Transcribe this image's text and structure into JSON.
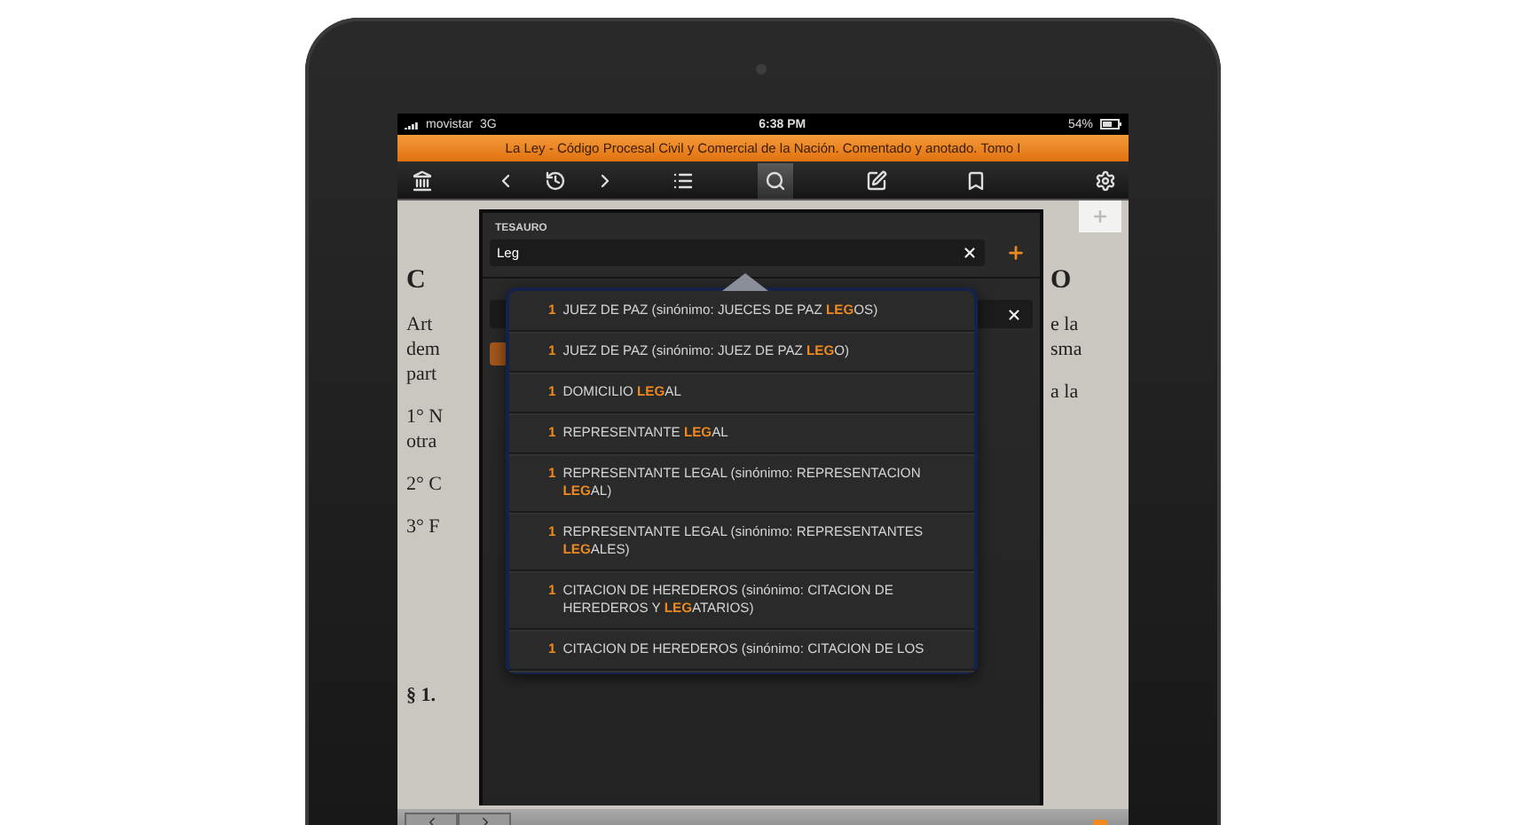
{
  "status_bar": {
    "carrier": "movistar",
    "network": "3G",
    "time": "6:38 PM",
    "battery": "54%"
  },
  "title_bar": {
    "title": "La Ley - Código Procesal Civil y Comercial de la Nación. Comentado y anotado. Tomo I"
  },
  "toolbar": {
    "items": [
      {
        "kind": "library",
        "selected": false
      },
      {
        "kind": "back",
        "selected": false
      },
      {
        "kind": "history",
        "selected": false
      },
      {
        "kind": "forward",
        "selected": false
      },
      {
        "kind": "contents",
        "selected": false
      },
      {
        "kind": "search",
        "selected": true
      },
      {
        "kind": "notes",
        "selected": false
      },
      {
        "kind": "bookmark",
        "selected": false
      },
      {
        "kind": "settings",
        "selected": false
      }
    ]
  },
  "page": {
    "left_fragments": [
      {
        "kind": "heading",
        "text": "C"
      },
      {
        "kind": "para",
        "text": "Art"
      },
      {
        "kind": "line",
        "text": "dem"
      },
      {
        "kind": "line",
        "text": "part"
      },
      {
        "kind": "para",
        "text": "1° N"
      },
      {
        "kind": "line",
        "text": "otra"
      },
      {
        "kind": "para",
        "text": "2° C"
      },
      {
        "kind": "para",
        "text": "3° F"
      },
      {
        "kind": "section",
        "text": "§ 1."
      }
    ],
    "right_fragments": [
      {
        "kind": "heading",
        "text": "O"
      },
      {
        "kind": "para",
        "text": "e la"
      },
      {
        "kind": "line",
        "text": "sma"
      },
      {
        "kind": "para",
        "text": "a la"
      }
    ]
  },
  "search_panel": {
    "label": "TESAURO",
    "query": "Leg",
    "suggestions": [
      {
        "count": "1",
        "text": "JUEZ DE PAZ (sinónimo: JUECES DE PAZ **LEG**OS)"
      },
      {
        "count": "1",
        "text": "JUEZ DE PAZ (sinónimo: JUEZ DE PAZ **LEG**O)"
      },
      {
        "count": "1",
        "text": "DOMICILIO **LEG**AL"
      },
      {
        "count": "1",
        "text": "REPRESENTANTE **LEG**AL"
      },
      {
        "count": "1",
        "text": "REPRESENTANTE LEGAL (sinónimo: REPRESENTACION **LEG**AL)"
      },
      {
        "count": "1",
        "text": "REPRESENTANTE LEGAL (sinónimo: REPRESENTANTES **LEG**ALES)"
      },
      {
        "count": "1",
        "text": "CITACION DE HEREDEROS (sinónimo: CITACION DE HEREDEROS Y **LEG**ATARIOS)"
      },
      {
        "count": "1",
        "text": "CITACION DE HEREDEROS (sinónimo: CITACION DE LOS"
      }
    ]
  }
}
